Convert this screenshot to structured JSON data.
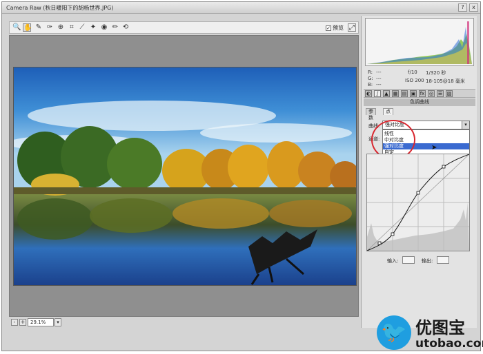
{
  "window": {
    "title": "Camera Raw (秋日暖阳下的胡杨世界.JPG)",
    "help_label": "?",
    "close_label": "x"
  },
  "toolbar": {
    "tools": [
      {
        "name": "zoom-tool-icon",
        "glyph": "🔍"
      },
      {
        "name": "hand-tool-icon",
        "glyph": "✋"
      },
      {
        "name": "white-balance-tool-icon",
        "glyph": "✎"
      },
      {
        "name": "color-sampler-tool-icon",
        "glyph": "✑"
      },
      {
        "name": "target-adjustment-tool-icon",
        "glyph": "⊕"
      },
      {
        "name": "crop-tool-icon",
        "glyph": "⌗"
      },
      {
        "name": "straighten-tool-icon",
        "glyph": "⟋"
      },
      {
        "name": "spot-removal-tool-icon",
        "glyph": "✦"
      },
      {
        "name": "red-eye-tool-icon",
        "glyph": "◉"
      },
      {
        "name": "adjustment-brush-icon",
        "glyph": "✏"
      },
      {
        "name": "graduated-filter-icon",
        "glyph": "▥"
      },
      {
        "name": "rotate-icon",
        "glyph": "⟲"
      }
    ],
    "preview_label": "预览",
    "preview_checked": "✓",
    "fullscreen_glyph": "⤢"
  },
  "zoom": {
    "minus": "-",
    "plus": "+",
    "value": "29.1%",
    "arrow": "▾"
  },
  "readout": {
    "r_label": "R:",
    "g_label": "G:",
    "b_label": "B:",
    "r_value": "---",
    "g_value": "---",
    "b_value": "---",
    "aperture": "f/10",
    "shutter": "1/320 秒",
    "iso": "ISO 200",
    "lens": "18-105@18 毫米"
  },
  "panel": {
    "section_title": "色调曲线",
    "tabs": [
      {
        "label": "参数"
      },
      {
        "label": "点"
      }
    ],
    "curve_label": "曲线:",
    "curve_value": "强对比度",
    "curve_arrow": "▾",
    "channel_label": "通道:",
    "curve_options": [
      {
        "label": "线性"
      },
      {
        "label": "中对比度"
      },
      {
        "label": "强对比度"
      },
      {
        "label": "自定"
      }
    ],
    "input_label": "输入:",
    "output_label": "输出:"
  },
  "watermark": {
    "cn": "优图宝",
    "url": "utobao.com"
  },
  "colors": {
    "accent": "#3a6ad0",
    "highlight_circle": "#d8262e",
    "watermark_blue": "#1f9ee0"
  }
}
